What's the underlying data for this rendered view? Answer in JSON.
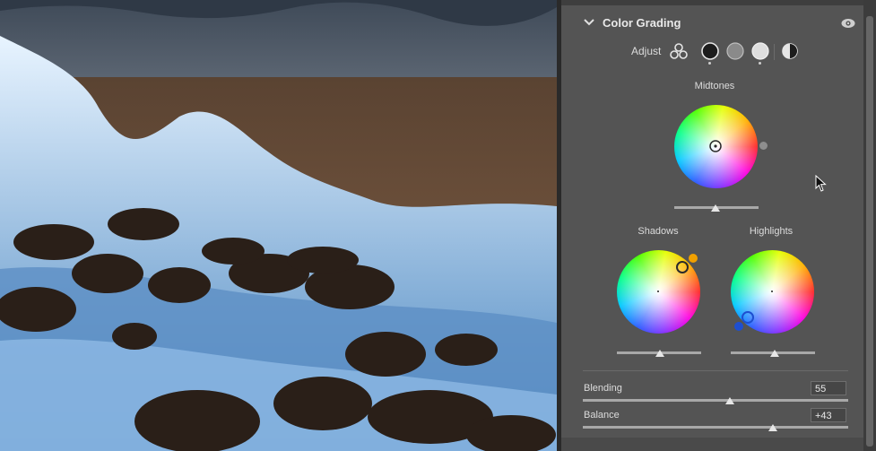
{
  "panel": {
    "title": "Color Grading",
    "adjust_label": "Adjust",
    "wheels": {
      "midtones": "Midtones",
      "shadows": "Shadows",
      "highlights": "Highlights"
    },
    "blending_label": "Blending",
    "blending_value": "55",
    "balance_label": "Balance",
    "balance_value": "+43"
  },
  "colors": {
    "panel_bg": "#545454",
    "shadow_accent": "#f0a000",
    "highlight_accent": "#1e4fd0"
  },
  "icons": [
    "chevron-down-icon",
    "eye-icon",
    "three-circles-icon",
    "shadows-circle-icon",
    "midtones-circle-icon",
    "highlights-circle-icon",
    "global-circle-icon",
    "mouse-cursor-icon"
  ]
}
